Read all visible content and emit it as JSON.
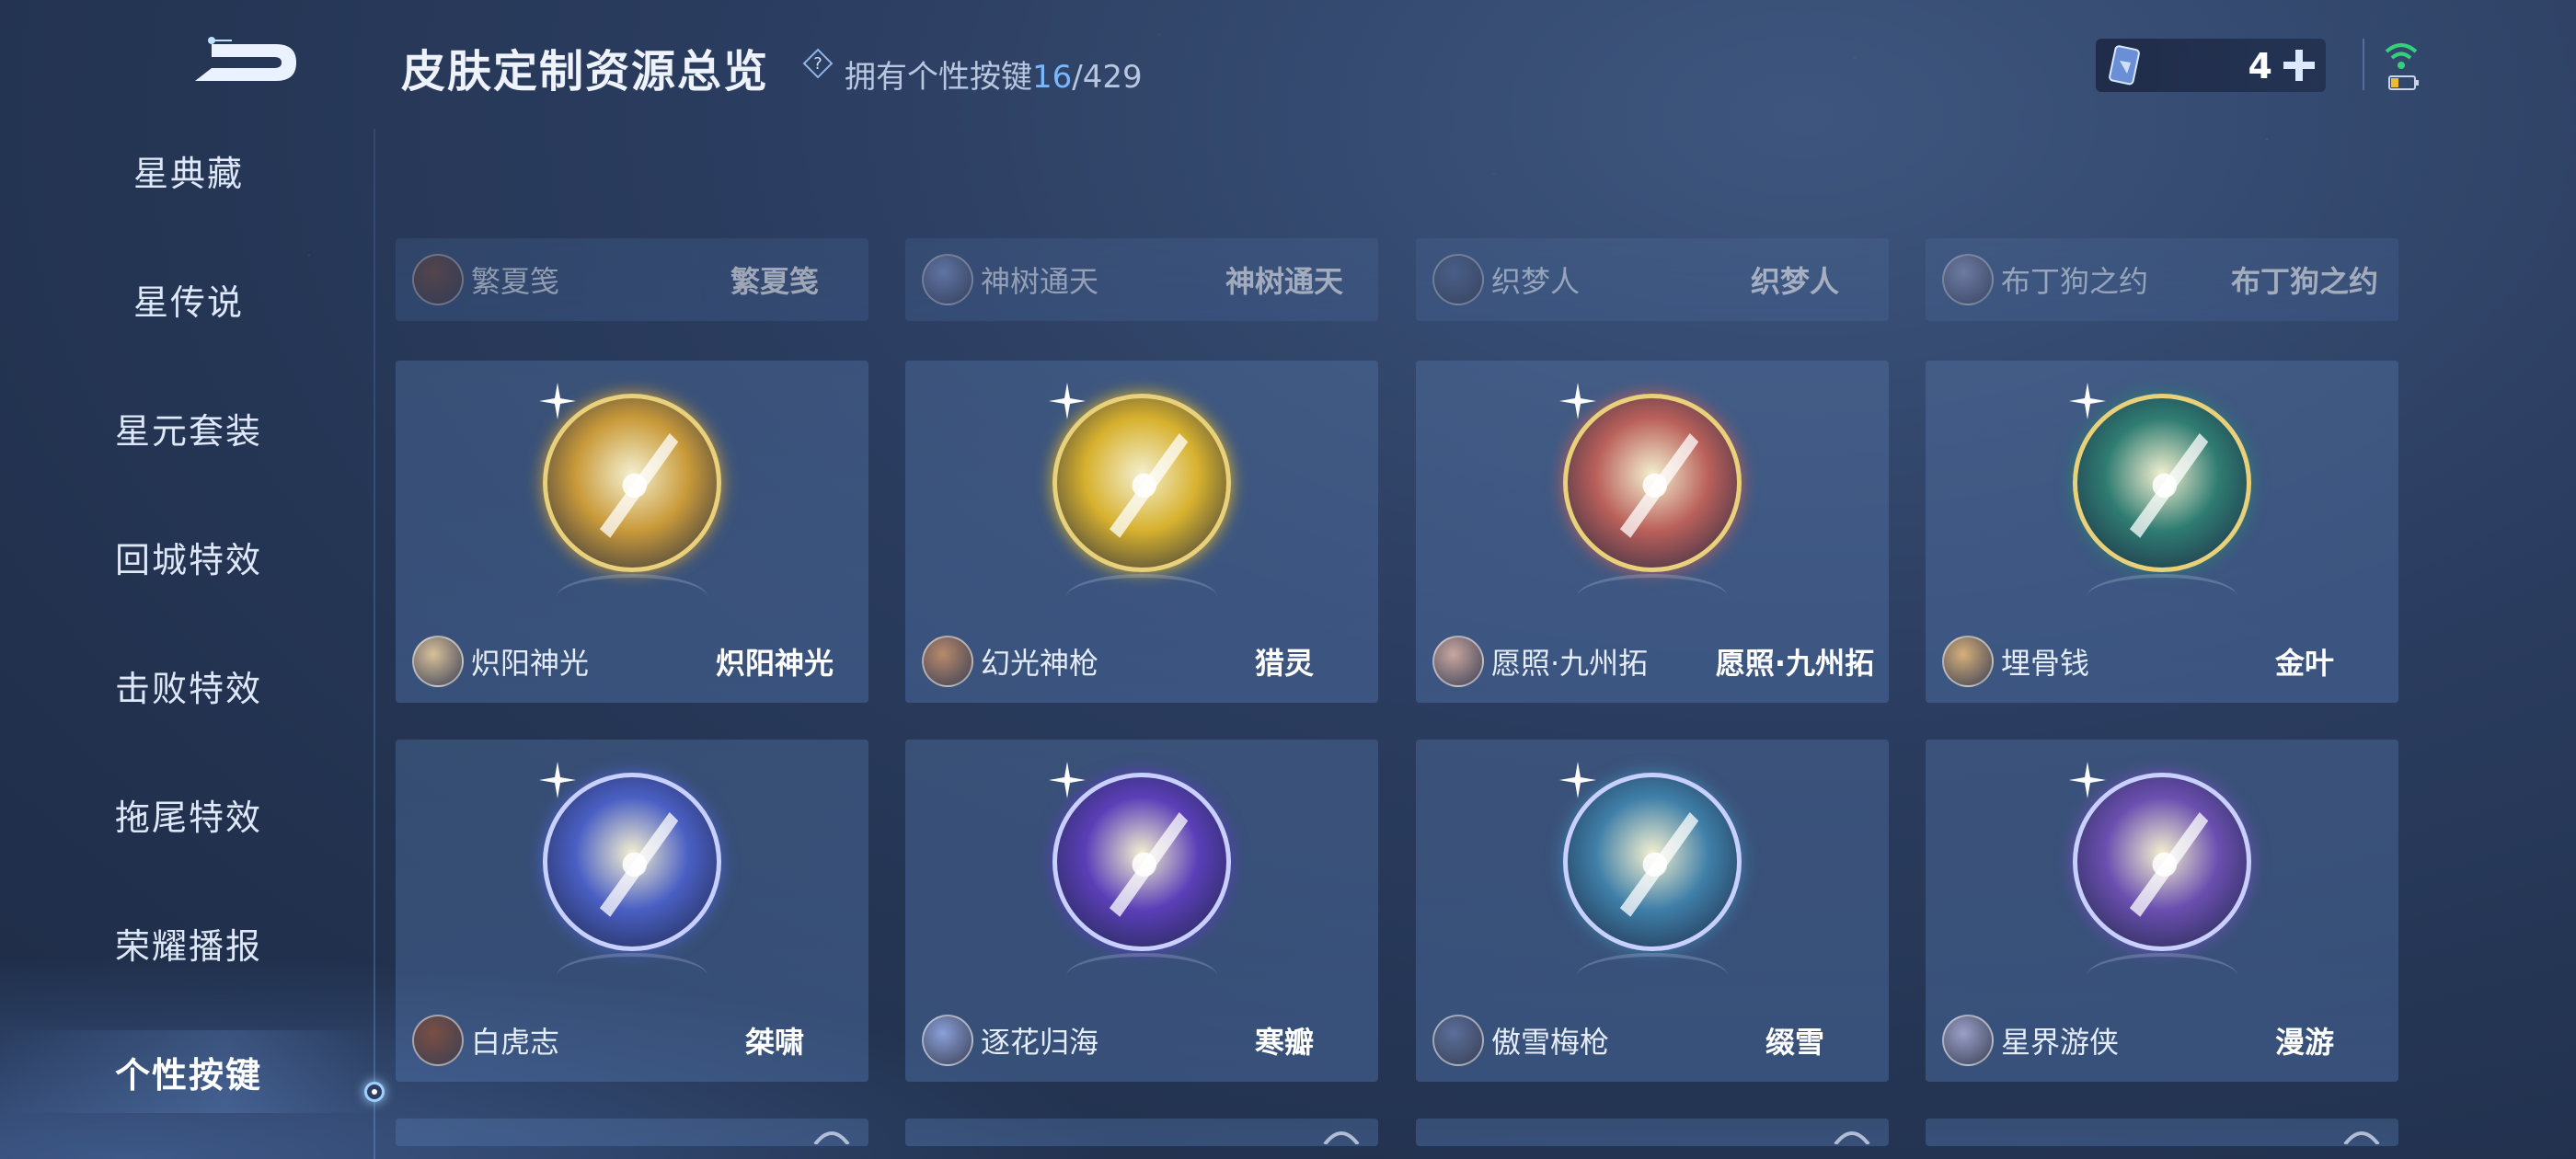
{
  "header": {
    "title": "皮肤定制资源总览",
    "owned_label": "拥有个性按键",
    "owned_count": "16",
    "owned_total": "/429",
    "currency_value": "4"
  },
  "sidebar": {
    "items": [
      {
        "label": "星典藏"
      },
      {
        "label": "星传说"
      },
      {
        "label": "星元套装"
      },
      {
        "label": "回城特效"
      },
      {
        "label": "击败特效"
      },
      {
        "label": "拖尾特效"
      },
      {
        "label": "荣耀播报"
      },
      {
        "label": "个性按键",
        "active": true
      }
    ]
  },
  "top_row": [
    {
      "hero": "繁夏笺",
      "skin": "繁夏笺"
    },
    {
      "hero": "神树通天",
      "skin": "神树通天"
    },
    {
      "hero": "织梦人",
      "skin": "织梦人"
    },
    {
      "hero": "布丁狗之约",
      "skin": "布丁狗之约"
    }
  ],
  "grid": [
    {
      "hero": "炽阳神光",
      "skin": "炽阳神光",
      "theme": "#c99a3a",
      "icon": "sun-blade-icon"
    },
    {
      "hero": "幻光神枪",
      "skin": "猎灵",
      "theme": "#d7b12e",
      "icon": "spear-icon"
    },
    {
      "hero": "愿照·九州拓",
      "skin": "愿照·九州拓",
      "theme": "#b9605a",
      "icon": "crimson-blade-icon"
    },
    {
      "hero": "埋骨钱",
      "skin": "金叶",
      "theme": "#2f7c72",
      "icon": "gold-leaf-sword-icon"
    },
    {
      "hero": "白虎志",
      "skin": "桀啸",
      "theme": "#4a5fc4",
      "icon": "tiger-claw-icon"
    },
    {
      "hero": "逐花归海",
      "skin": "寒瓣",
      "theme": "#5a3fb8",
      "icon": "ice-petal-icon"
    },
    {
      "hero": "傲雪梅枪",
      "skin": "缀雪",
      "theme": "#3f7fa8",
      "icon": "snow-spear-icon"
    },
    {
      "hero": "星界游侠",
      "skin": "漫游",
      "theme": "#6a4fb0",
      "icon": "star-dagger-icon"
    }
  ]
}
